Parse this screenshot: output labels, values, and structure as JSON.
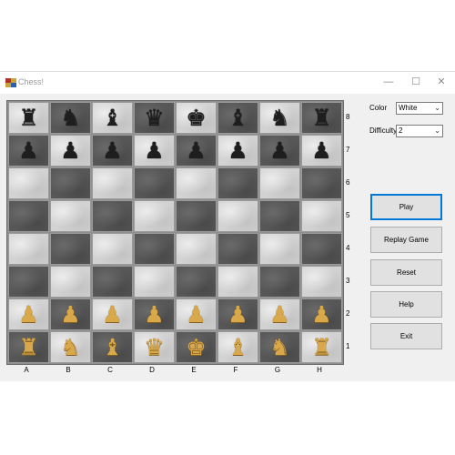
{
  "window": {
    "title": "Chess!",
    "minimize_icon": "minimize-icon",
    "maximize_icon": "maximize-icon",
    "close_icon": "close-icon"
  },
  "controls": {
    "color_label": "Color",
    "color_value": "White",
    "difficulty_label": "Difficulty",
    "difficulty_value": "2"
  },
  "buttons": [
    {
      "id": "play",
      "label": "Play"
    },
    {
      "id": "replay-game",
      "label": "Replay Game"
    },
    {
      "id": "reset",
      "label": "Reset"
    },
    {
      "id": "help",
      "label": "Help"
    },
    {
      "id": "exit",
      "label": "Exit"
    }
  ],
  "board": {
    "files": [
      "A",
      "B",
      "C",
      "D",
      "E",
      "F",
      "G",
      "H"
    ],
    "ranks": [
      "8",
      "7",
      "6",
      "5",
      "4",
      "3",
      "2",
      "1"
    ],
    "rows": [
      [
        "bR",
        "bN",
        "bB",
        "bQ",
        "bK",
        "bB",
        "bN",
        "bR"
      ],
      [
        "bP",
        "bP",
        "bP",
        "bP",
        "bP",
        "bP",
        "bP",
        "bP"
      ],
      [
        "",
        "",
        "",
        "",
        "",
        "",
        "",
        ""
      ],
      [
        "",
        "",
        "",
        "",
        "",
        "",
        "",
        ""
      ],
      [
        "",
        "",
        "",
        "",
        "",
        "",
        "",
        ""
      ],
      [
        "",
        "",
        "",
        "",
        "",
        "",
        "",
        ""
      ],
      [
        "wP",
        "wP",
        "wP",
        "wP",
        "wP",
        "wP",
        "wP",
        "wP"
      ],
      [
        "wR",
        "wN",
        "wB",
        "wQ",
        "wK",
        "wB",
        "wN",
        "wR"
      ]
    ],
    "light_color": "#d2d2d2",
    "dark_color": "#575757"
  }
}
